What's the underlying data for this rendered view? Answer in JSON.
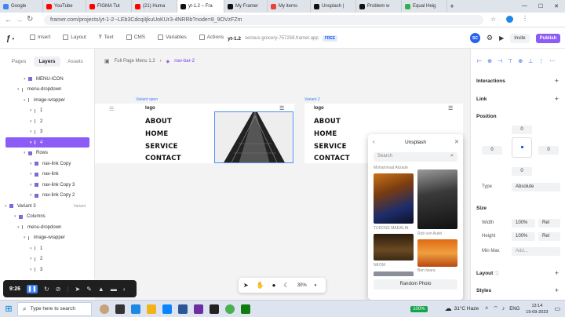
{
  "browser": {
    "tabs": [
      {
        "label": "Google",
        "color": "#4285f4"
      },
      {
        "label": "YouTube",
        "color": "#ff0000"
      },
      {
        "label": "FIGMA Tut",
        "color": "#ff0000"
      },
      {
        "label": "(21) Huma",
        "color": "#ff0000"
      },
      {
        "label": "yt-1.2 – Fra",
        "color": "#111111"
      },
      {
        "label": "My Framer",
        "color": "#111111"
      },
      {
        "label": "My items",
        "color": "#ea4335"
      },
      {
        "label": "Unsplash |",
        "color": "#111111"
      },
      {
        "label": "Problem w",
        "color": "#111111"
      },
      {
        "label": "Equal Heig",
        "color": "#2db34a"
      }
    ],
    "url": "framer.com/projects/yt-1-2--LEb3CdcqiIjkuUoKUr3-4NRRb?node=8_9OVzFZm"
  },
  "topbar": {
    "insert": "Insert",
    "layout": "Layout",
    "text": "Text",
    "cms": "CMS",
    "variables": "Variables",
    "actions": "Actions",
    "project_name": "yt-1.2",
    "project_domain": "serious-grocery-757259.framer.app",
    "plan_badge": "FREE",
    "avatar": "SC",
    "invite": "Invite",
    "publish": "Publish"
  },
  "left_panel": {
    "tabs": [
      "Pages",
      "Layers",
      "Assets"
    ],
    "layers": [
      {
        "label": "MENU-ICON",
        "indent": 38,
        "type": "icon"
      },
      {
        "label": "menu-dropdown",
        "indent": 30,
        "type": "bar"
      },
      {
        "label": "image-wrapper",
        "indent": 38,
        "type": "bar"
      },
      {
        "label": "1",
        "indent": 46,
        "type": "bar"
      },
      {
        "label": "2",
        "indent": 46,
        "type": "bar"
      },
      {
        "label": "3",
        "indent": 46,
        "type": "bar"
      },
      {
        "label": "4",
        "indent": 46,
        "type": "bar",
        "selected": true
      },
      {
        "label": "Rows",
        "indent": 38,
        "type": "icon"
      },
      {
        "label": "nav-link Copy",
        "indent": 46,
        "type": "icon"
      },
      {
        "label": "nav-link",
        "indent": 46,
        "type": "icon"
      },
      {
        "label": "nav-link Copy 3",
        "indent": 46,
        "type": "icon"
      },
      {
        "label": "nav-link Copy 2",
        "indent": 46,
        "type": "icon"
      },
      {
        "label": "Variant 3",
        "indent": 14,
        "type": "icon",
        "badge": "Variant"
      },
      {
        "label": "Columns",
        "indent": 26,
        "type": "icon"
      },
      {
        "label": "menu-dropdown",
        "indent": 30,
        "type": "bar"
      },
      {
        "label": "image-wrapper",
        "indent": 38,
        "type": "bar"
      },
      {
        "label": "1",
        "indent": 46,
        "type": "bar"
      },
      {
        "label": "2",
        "indent": 46,
        "type": "bar"
      },
      {
        "label": "3",
        "indent": 46,
        "type": "bar"
      }
    ]
  },
  "canvas": {
    "breadcrumb": [
      "Full Page Menu 1.2",
      "nav-bar-2"
    ],
    "frame1_label": "Variant  open",
    "frame2_label": "Variant 2",
    "logo": "logo",
    "menu": [
      "ABOUT",
      "HOME",
      "SERVICE",
      "CONTACT"
    ],
    "zoom": "30%"
  },
  "unsplash": {
    "title": "Unsplash",
    "search_placeholder": "Search",
    "credit_top": "Mohammad Alizade",
    "photos": [
      {
        "credit": "TUDOSE MADALIN"
      },
      {
        "credit": "Rob von Autel"
      },
      {
        "credit": "NEOM"
      },
      {
        "credit": "Ben Iwara"
      }
    ],
    "random_button": "Random Photo"
  },
  "right_panel": {
    "interactions": "Interactions",
    "link": "Link",
    "position": "Position",
    "pos_values": [
      "0",
      "0",
      "0",
      "0"
    ],
    "type_label": "Type",
    "type_value": "Absolute",
    "size": "Size",
    "width_label": "Width",
    "width_value": "100%",
    "width_unit": "Rel",
    "height_label": "Height",
    "height_value": "100%",
    "height_unit": "Rel",
    "minmax_label": "Min Max",
    "minmax_add": "Add...",
    "layout": "Layout",
    "styles": "Styles"
  },
  "dock": {
    "time": "9:26"
  },
  "taskbar": {
    "search": "Type here to search",
    "battery": "100%",
    "weather": "31°C  Haze",
    "lang": "ENG",
    "clock_time": "13:14",
    "clock_date": "15-09-2023"
  }
}
